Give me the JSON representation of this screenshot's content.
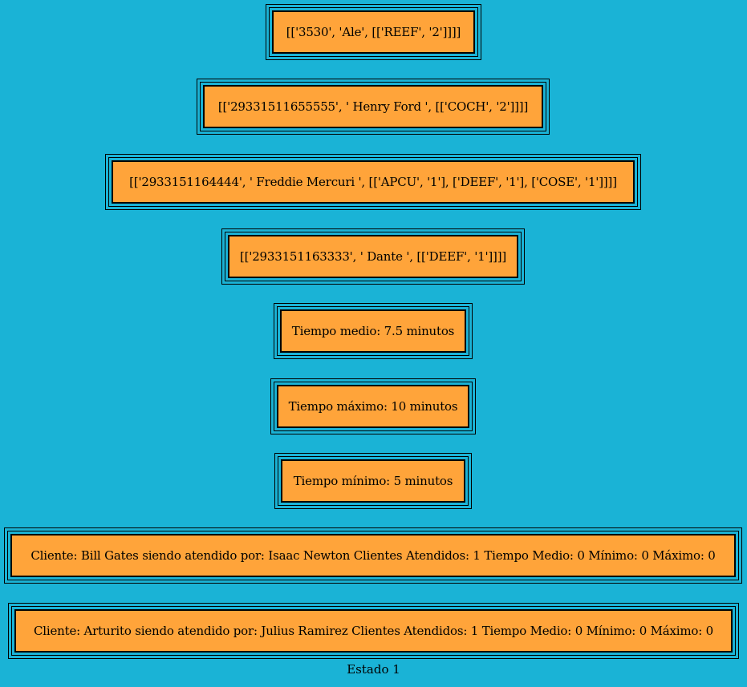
{
  "nodes": [
    "[['3530', 'Ale', [['REEF', '2']]]]",
    "[['29331511655555', ' Henry Ford ', [['COCH', '2']]]]",
    "[['2933151164444', ' Freddie Mercuri ', [['APCU', '1'], ['DEEF', '1'], ['COSE', '1']]]]",
    "[['2933151163333', ' Dante ', [['DEEF', '1']]]]",
    "Tiempo medio: 7.5 minutos",
    "Tiempo máximo: 10 minutos",
    "Tiempo mínimo: 5 minutos",
    "Cliente:  Bill Gates  siendo atendido por:  Isaac Newton Clientes Atendidos: 1 Tiempo Medio: 0 Mínimo: 0 Máximo: 0",
    "Cliente:  Arturito  siendo atendido por:  Julius Ramirez Clientes Atendidos: 1 Tiempo Medio: 0 Mínimo: 0 Máximo: 0"
  ],
  "caption": "Estado 1",
  "colors": {
    "background": "#1ab3d6",
    "node_fill": "#ffa43a",
    "border": "#000000"
  }
}
